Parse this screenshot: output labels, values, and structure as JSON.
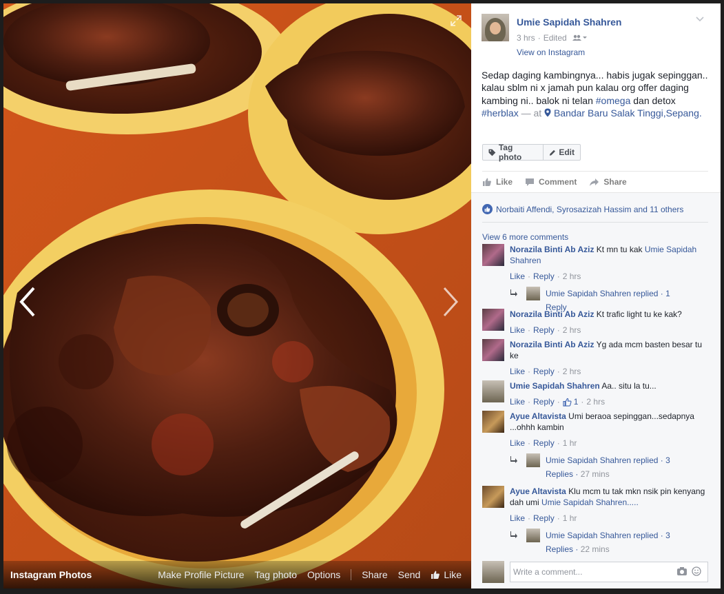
{
  "photo": {
    "album_title": "Instagram Photos",
    "actions": {
      "make_profile": "Make Profile Picture",
      "tag_photo": "Tag photo",
      "options": "Options",
      "share": "Share",
      "send": "Send",
      "like": "Like"
    }
  },
  "post": {
    "author": "Umie Sapidah Shahren",
    "time": "3 hrs",
    "edited": "Edited",
    "view_on": "View on Instagram",
    "caption_text": "Sedap daging kambingnya... habis jugak sepinggan.. kalau sblm ni x jamah pun kalau org offer daging kambing ni.. balok ni telan",
    "hashtag1": "#omega",
    "and_word": "dan detox",
    "hashtag2": "#herblax",
    "at_text": "— at",
    "location": "Bandar Baru Salak Tinggi,Sepang",
    "period": ".",
    "tag_button": "Tag photo",
    "edit_button": "Edit",
    "like": "Like",
    "comment": "Comment",
    "share": "Share",
    "likes_summary": "Norbaiti Affendi, Syrosazizah Hassim and 11 others",
    "view_more": "View 6 more comments"
  },
  "comments": [
    {
      "name": "Norazila Binti Ab Aziz",
      "text": "Kt mn tu kak",
      "mention": "Umie Sapidah Shahren",
      "like": "Like",
      "reply": "Reply",
      "time": "2 hrs",
      "reply_summary": {
        "text": "Umie Sapidah Shahren replied",
        "count": "1 Reply",
        "time": ""
      }
    },
    {
      "name": "Norazila Binti Ab Aziz",
      "text": "Kt trafic light tu ke kak?",
      "like": "Like",
      "reply": "Reply",
      "time": "2 hrs"
    },
    {
      "name": "Norazila Binti Ab Aziz",
      "text": "Yg ada mcm basten besar tu ke",
      "like": "Like",
      "reply": "Reply",
      "time": "2 hrs"
    },
    {
      "name": "Umie Sapidah Shahren",
      "text": "Aa.. situ la tu...",
      "like": "Like",
      "reply": "Reply",
      "likes": "1",
      "time": "2 hrs"
    },
    {
      "name": "Ayue Altavista",
      "text": "Umi beraoa sepinggan...sedapnya ...ohhh kambin",
      "like": "Like",
      "reply": "Reply",
      "time": "1 hr",
      "reply_summary": {
        "text": "Umie Sapidah Shahren replied",
        "count": "3 Replies",
        "time": "27 mins"
      }
    },
    {
      "name": "Ayue Altavista",
      "text": "Klu mcm tu tak mkn nsik pin kenyang dah umi",
      "mention": "Umie Sapidah Shahren.....",
      "like": "Like",
      "reply": "Reply",
      "time": "1 hr",
      "reply_summary": {
        "text": "Umie Sapidah Shahren replied",
        "count": "3 Replies",
        "time": "22 mins"
      }
    }
  ],
  "composer": {
    "placeholder": "Write a comment..."
  },
  "colors": {
    "link": "#365899",
    "muted": "#90949c",
    "table_orange": "#c9531b",
    "plate_yellow": "#f0c24a"
  },
  "icons": [
    "expand-icon",
    "chevron-left-icon",
    "chevron-right-icon",
    "audience-icon",
    "chevron-down-icon",
    "tag-icon",
    "pencil-icon",
    "thumbs-up-icon",
    "comment-icon",
    "share-icon",
    "reply-arrow-icon",
    "camera-icon",
    "emoji-icon",
    "location-pin-icon"
  ]
}
